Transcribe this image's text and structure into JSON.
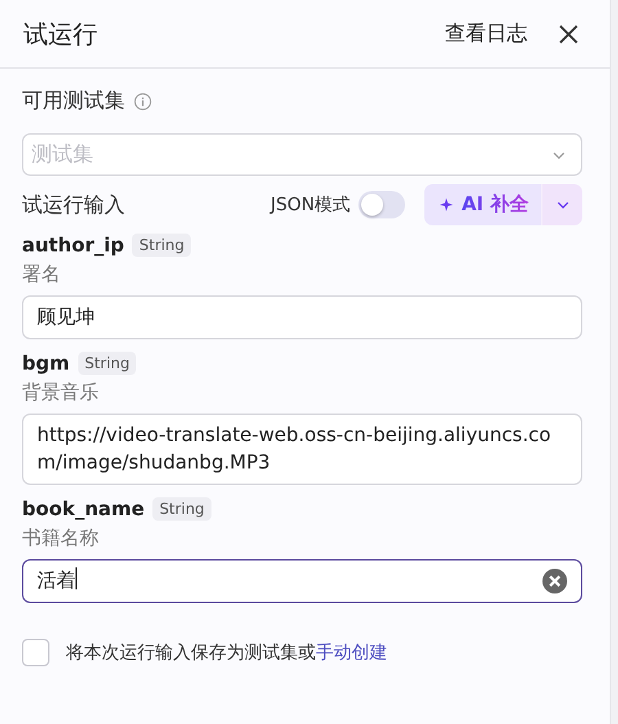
{
  "header": {
    "title": "试运行",
    "log_link": "查看日志"
  },
  "test_set": {
    "label": "可用测试集",
    "placeholder": "测试集"
  },
  "run_input": {
    "label": "试运行输入",
    "json_mode": {
      "label": "JSON模式",
      "on": false
    },
    "ai_button": "AI 补全"
  },
  "params": [
    {
      "name": "author_ip",
      "type": "String",
      "description": "署名",
      "value": "顾见坤",
      "focused": false
    },
    {
      "name": "bgm",
      "type": "String",
      "description": "背景音乐",
      "value": "https://video-translate-web.oss-cn-beijing.aliyuncs.com/image/shudanbg.MP3",
      "focused": false
    },
    {
      "name": "book_name",
      "type": "String",
      "description": "书籍名称",
      "value": "活着",
      "focused": true
    }
  ],
  "save": {
    "checked": false,
    "text": "将本次运行输入保存为测试集或",
    "link": "手动创建"
  }
}
